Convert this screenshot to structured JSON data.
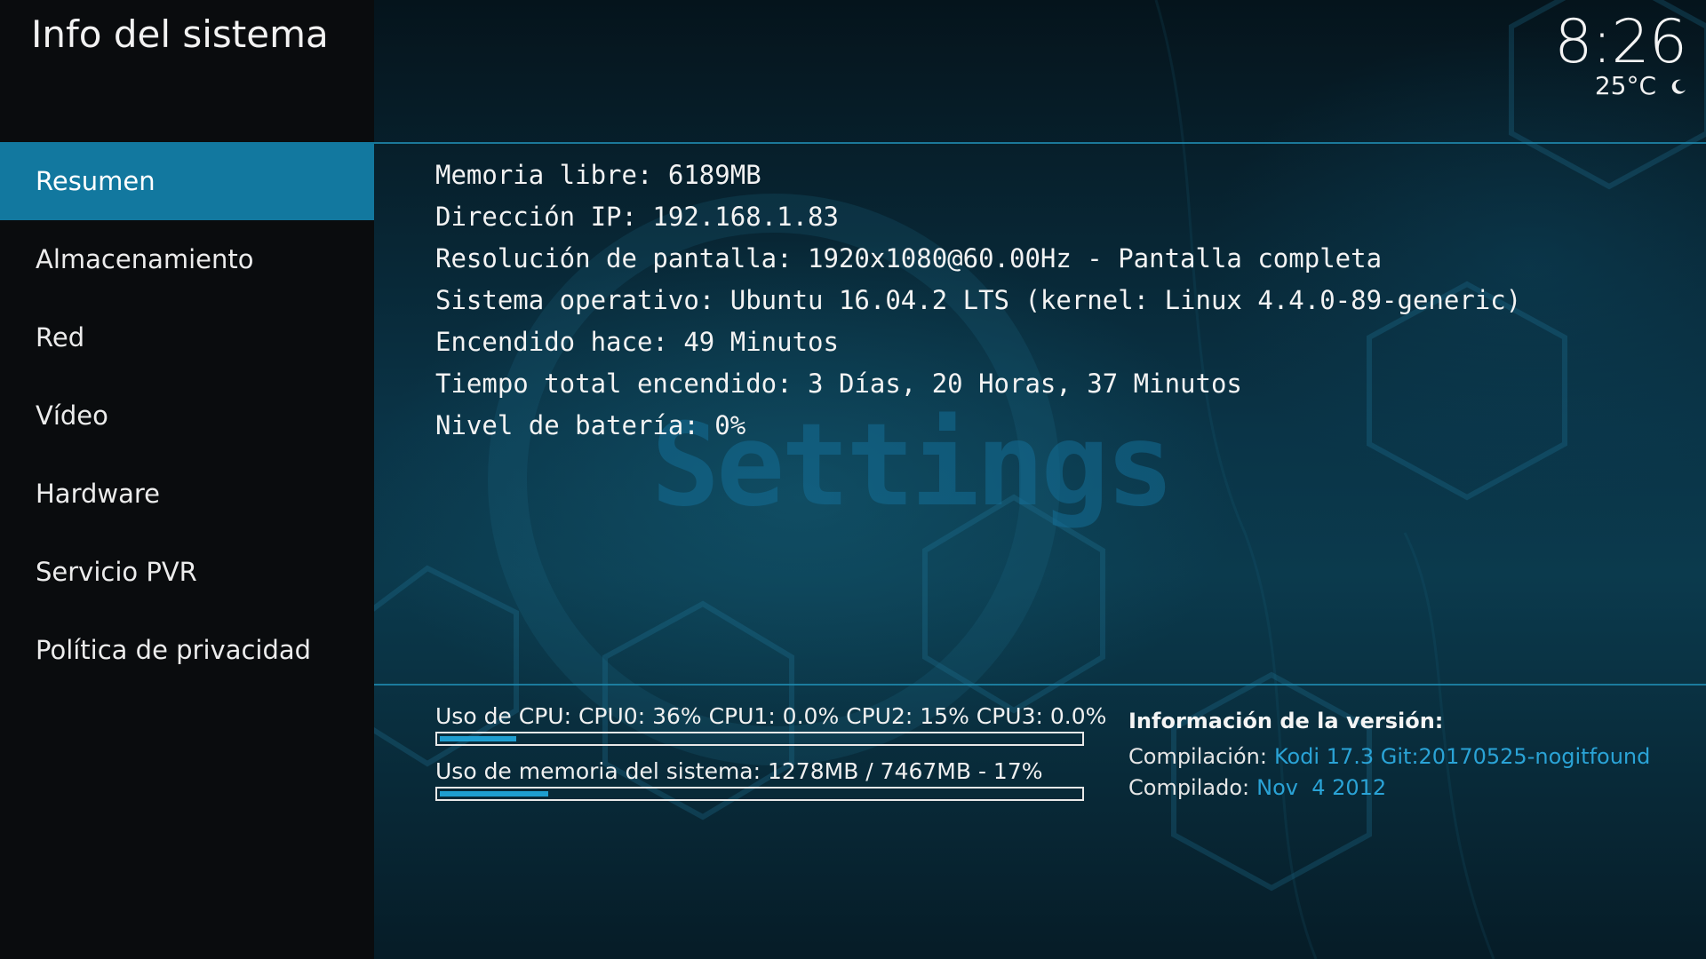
{
  "header": {
    "title": "Info del sistema",
    "time": "8:26",
    "temperature": "25°C",
    "weather_icon": "moon-icon"
  },
  "sidebar": {
    "items": [
      {
        "label": "Resumen",
        "selected": true
      },
      {
        "label": "Almacenamiento",
        "selected": false
      },
      {
        "label": "Red",
        "selected": false
      },
      {
        "label": "Vídeo",
        "selected": false
      },
      {
        "label": "Hardware",
        "selected": false
      },
      {
        "label": "Servicio PVR",
        "selected": false
      },
      {
        "label": "Política de privacidad",
        "selected": false
      }
    ]
  },
  "background": {
    "watermark": "Settings"
  },
  "summary": {
    "lines": [
      "Memoria libre: 6189MB",
      "Dirección IP: 192.168.1.83",
      "Resolución de pantalla: 1920x1080@60.00Hz - Pantalla completa",
      "Sistema operativo: Ubuntu 16.04.2 LTS (kernel: Linux 4.4.0-89-generic)",
      "Encendido hace: 49 Minutos",
      "Tiempo total encendido: 3 Días, 20 Horas, 37 Minutos",
      "Nivel de batería: 0%"
    ]
  },
  "usage": {
    "cpu_label": "Uso de CPU: CPU0:  36% CPU1: 0.0% CPU2:  15% CPU3: 0.0%",
    "cpu_percent": 12,
    "memory_label": "Uso de memoria del sistema: 1278MB / 7467MB - 17%",
    "memory_percent": 17
  },
  "version": {
    "title": "Información de la versión:",
    "build_label": "Compilación:",
    "build_value": "Kodi 17.3 Git:20170525-nogitfound",
    "compiled_label": "Compilado:",
    "compiled_value": "Nov  4 2012"
  },
  "colors": {
    "accent": "#12789f",
    "link": "#2aa3d6",
    "bar_fill": "#1f9ed0"
  }
}
